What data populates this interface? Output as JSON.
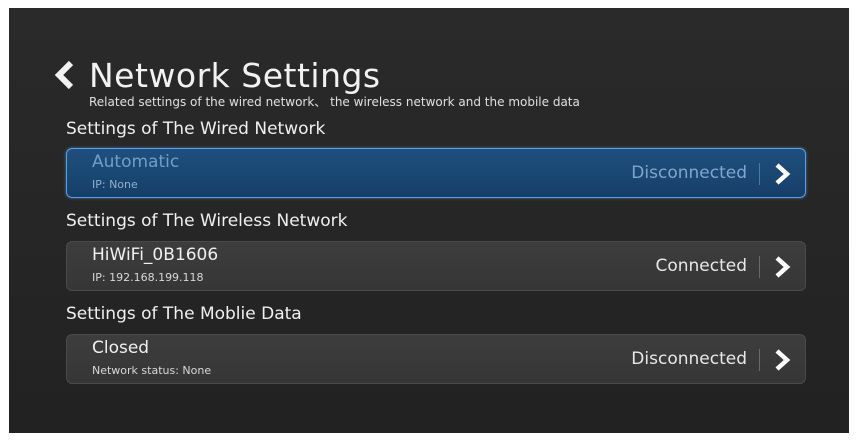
{
  "header": {
    "title": "Network Settings",
    "subtitle": "Related settings of the wired network、 the wireless network and the mobile data",
    "back_icon": "chevron-left-icon"
  },
  "sections": [
    {
      "title": "Settings of The Wired Network",
      "item": {
        "name": "Automatic",
        "detail": "IP: None",
        "status": "Disconnected",
        "selected": true
      }
    },
    {
      "title": "Settings of The Wireless Network",
      "item": {
        "name": "HiWiFi_0B1606",
        "detail": "IP: 192.168.199.118",
        "status": "Connected",
        "selected": false
      }
    },
    {
      "title": "Settings of The Moblie Data",
      "item": {
        "name": "Closed",
        "detail": "Network status: None",
        "status": "Disconnected",
        "selected": false
      }
    }
  ],
  "colors": {
    "background": "#262626",
    "card": "#3a3a3a",
    "card_selected": "#1a4773",
    "card_selected_border": "#5aa0e6",
    "text": "#f0f0f0"
  }
}
